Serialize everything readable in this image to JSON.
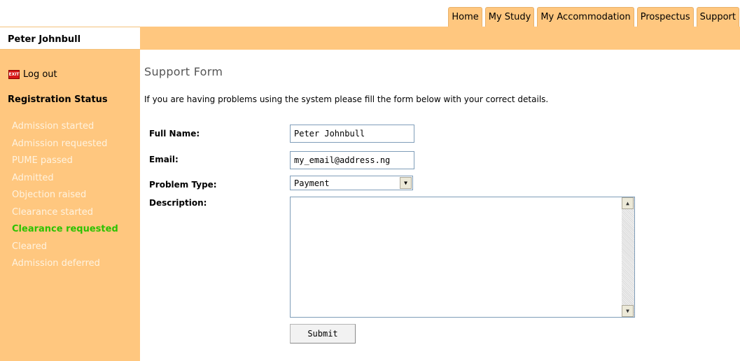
{
  "nav": {
    "tabs": [
      "Home",
      "My Study",
      "My Accommodation",
      "Prospectus",
      "Support"
    ]
  },
  "user": {
    "name": "Peter Johnbull"
  },
  "sidebar": {
    "logout_label": "Log out",
    "logout_icon": "exit-icon",
    "registration_title": "Registration Status",
    "statuses": [
      {
        "label": "Admission started",
        "current": false
      },
      {
        "label": "Admission requested",
        "current": false
      },
      {
        "label": "PUME passed",
        "current": false
      },
      {
        "label": "Admitted",
        "current": false
      },
      {
        "label": "Objection raised",
        "current": false
      },
      {
        "label": "Clearance started",
        "current": false
      },
      {
        "label": "Clearance requested",
        "current": true
      },
      {
        "label": "Cleared",
        "current": false
      },
      {
        "label": "Admission deferred",
        "current": false
      }
    ]
  },
  "form": {
    "title": "Support Form",
    "intro": "If you are having problems using the system please fill the form below with your correct details.",
    "full_name_label": "Full Name:",
    "full_name_value": "Peter Johnbull",
    "email_label": "Email:",
    "email_value": "my_email@address.ng",
    "problem_type_label": "Problem Type:",
    "problem_type_value": "Payment",
    "description_label": "Description:",
    "submit_label": "Submit"
  },
  "colors": {
    "accent": "#ffc77f",
    "current_status": "#2cc200",
    "inactive_status": "#fff3e0"
  }
}
